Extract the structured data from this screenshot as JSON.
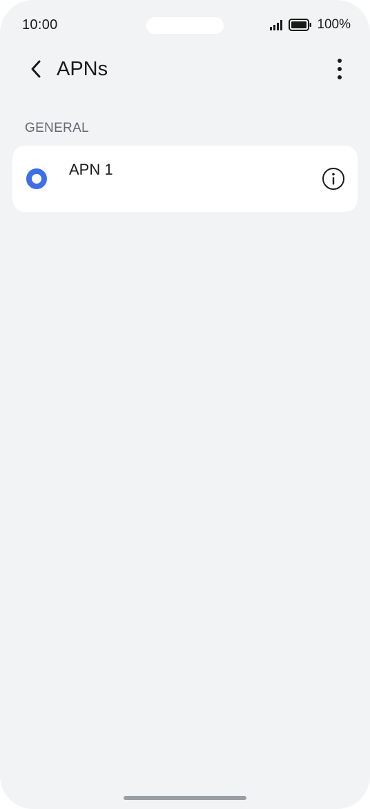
{
  "status_bar": {
    "time": "10:00",
    "battery": "100%",
    "icons": [
      "signal-icon",
      "battery-icon"
    ]
  },
  "header": {
    "title": "APNs",
    "back_icon": "chevron-left-icon",
    "more_icon": "more-vertical-icon"
  },
  "section": {
    "label": "GENERAL",
    "items": [
      {
        "name": "APN 1",
        "selected": true,
        "info_icon": "info-icon"
      }
    ]
  },
  "colors": {
    "background": "#f2f3f5",
    "card": "#ffffff",
    "accent": "#3f6fe6",
    "text": "#1a1a1a",
    "section_label": "#666a70"
  }
}
